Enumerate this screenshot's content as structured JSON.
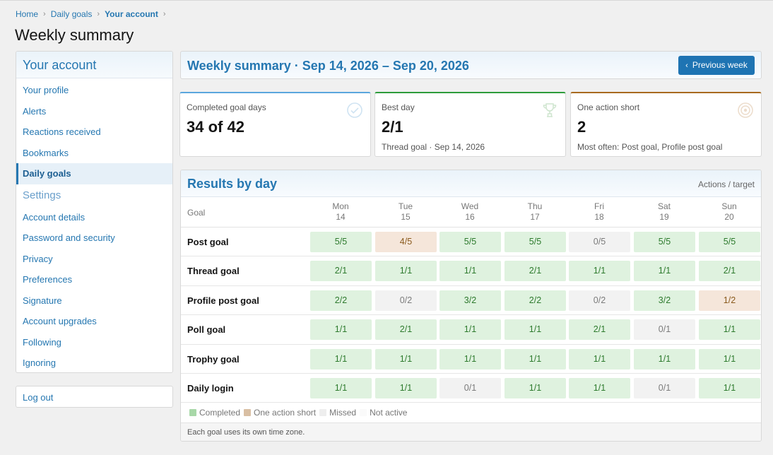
{
  "breadcrumb": [
    {
      "label": "Home"
    },
    {
      "label": "Daily goals"
    },
    {
      "label": "Your account"
    }
  ],
  "page_title": "Weekly summary",
  "sidebar": {
    "section1": "Your account",
    "items1": [
      "Your profile",
      "Alerts",
      "Reactions received",
      "Bookmarks",
      "Daily goals"
    ],
    "active_item": "Daily goals",
    "section2": "Settings",
    "items2": [
      "Account details",
      "Password and security",
      "Privacy",
      "Preferences",
      "Signature",
      "Account upgrades",
      "Following",
      "Ignoring"
    ],
    "logout": "Log out"
  },
  "main": {
    "title": "Weekly summary · Sep 14, 2026 – Sep 20, 2026",
    "prev_week": "Previous week"
  },
  "cards": [
    {
      "label": "Completed goal days",
      "value": "34 of 42",
      "sub": "",
      "icon": "check-circle-icon"
    },
    {
      "label": "Best day",
      "value": "2/1",
      "sub": "Thread goal · Sep 14, 2026",
      "icon": "trophy-icon"
    },
    {
      "label": "One action short",
      "value": "2",
      "sub": "Most often: Post goal, Profile post goal",
      "icon": "target-icon"
    }
  ],
  "results": {
    "title": "Results by day",
    "hint": "Actions / target",
    "goal_header": "Goal",
    "days": [
      {
        "name": "Mon",
        "date": "14"
      },
      {
        "name": "Tue",
        "date": "15"
      },
      {
        "name": "Wed",
        "date": "16"
      },
      {
        "name": "Thu",
        "date": "17"
      },
      {
        "name": "Fri",
        "date": "18"
      },
      {
        "name": "Sat",
        "date": "19"
      },
      {
        "name": "Sun",
        "date": "20"
      }
    ],
    "rows": [
      {
        "goal": "Post goal",
        "cells": [
          {
            "v": "5/5",
            "s": "completed"
          },
          {
            "v": "4/5",
            "s": "short"
          },
          {
            "v": "5/5",
            "s": "completed"
          },
          {
            "v": "5/5",
            "s": "completed"
          },
          {
            "v": "0/5",
            "s": "missed"
          },
          {
            "v": "5/5",
            "s": "completed"
          },
          {
            "v": "5/5",
            "s": "completed"
          }
        ]
      },
      {
        "goal": "Thread goal",
        "cells": [
          {
            "v": "2/1",
            "s": "completed"
          },
          {
            "v": "1/1",
            "s": "completed"
          },
          {
            "v": "1/1",
            "s": "completed"
          },
          {
            "v": "2/1",
            "s": "completed"
          },
          {
            "v": "1/1",
            "s": "completed"
          },
          {
            "v": "1/1",
            "s": "completed"
          },
          {
            "v": "2/1",
            "s": "completed"
          }
        ]
      },
      {
        "goal": "Profile post goal",
        "cells": [
          {
            "v": "2/2",
            "s": "completed"
          },
          {
            "v": "0/2",
            "s": "missed"
          },
          {
            "v": "3/2",
            "s": "completed"
          },
          {
            "v": "2/2",
            "s": "completed"
          },
          {
            "v": "0/2",
            "s": "missed"
          },
          {
            "v": "3/2",
            "s": "completed"
          },
          {
            "v": "1/2",
            "s": "short"
          }
        ]
      },
      {
        "goal": "Poll goal",
        "cells": [
          {
            "v": "1/1",
            "s": "completed"
          },
          {
            "v": "2/1",
            "s": "completed"
          },
          {
            "v": "1/1",
            "s": "completed"
          },
          {
            "v": "1/1",
            "s": "completed"
          },
          {
            "v": "2/1",
            "s": "completed"
          },
          {
            "v": "0/1",
            "s": "missed"
          },
          {
            "v": "1/1",
            "s": "completed"
          }
        ]
      },
      {
        "goal": "Trophy goal",
        "cells": [
          {
            "v": "1/1",
            "s": "completed"
          },
          {
            "v": "1/1",
            "s": "completed"
          },
          {
            "v": "1/1",
            "s": "completed"
          },
          {
            "v": "1/1",
            "s": "completed"
          },
          {
            "v": "1/1",
            "s": "completed"
          },
          {
            "v": "1/1",
            "s": "completed"
          },
          {
            "v": "1/1",
            "s": "completed"
          }
        ]
      },
      {
        "goal": "Daily login",
        "cells": [
          {
            "v": "1/1",
            "s": "completed"
          },
          {
            "v": "1/1",
            "s": "completed"
          },
          {
            "v": "0/1",
            "s": "missed"
          },
          {
            "v": "1/1",
            "s": "completed"
          },
          {
            "v": "1/1",
            "s": "completed"
          },
          {
            "v": "0/1",
            "s": "missed"
          },
          {
            "v": "1/1",
            "s": "completed"
          }
        ]
      }
    ],
    "legend": [
      {
        "label": "Completed",
        "color": "#a8d8a8"
      },
      {
        "label": "One action short",
        "color": "#d9bfa3"
      },
      {
        "label": "Missed",
        "color": "#eeeeee"
      },
      {
        "label": "Not active",
        "color": "#fafafa"
      }
    ],
    "footnote": "Each goal uses its own time zone."
  }
}
